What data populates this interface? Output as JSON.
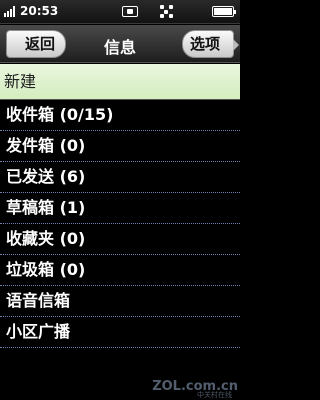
{
  "status_bar": {
    "time": "20:53",
    "battery_level": 1.0,
    "icons": [
      "signal-icon",
      "message-icon",
      "connection-icon",
      "battery-icon"
    ]
  },
  "header": {
    "back_label": "返回",
    "title": "信息",
    "options_label": "选项"
  },
  "menu": {
    "new_label": "新建",
    "items": [
      {
        "label": "收件箱 (0/15)"
      },
      {
        "label": "发件箱 (0)"
      },
      {
        "label": "已发送 (6)"
      },
      {
        "label": "草稿箱 (1)"
      },
      {
        "label": "收藏夹 (0)"
      },
      {
        "label": "垃圾箱 (0)"
      },
      {
        "label": "语音信箱"
      },
      {
        "label": "小区广播"
      }
    ]
  },
  "watermark": {
    "text": "ZOL.com.cn",
    "sub": "中关村在线"
  },
  "colors": {
    "selected_bg": "#dcefcc",
    "divider": "#6d7fb0",
    "background": "#000000"
  }
}
